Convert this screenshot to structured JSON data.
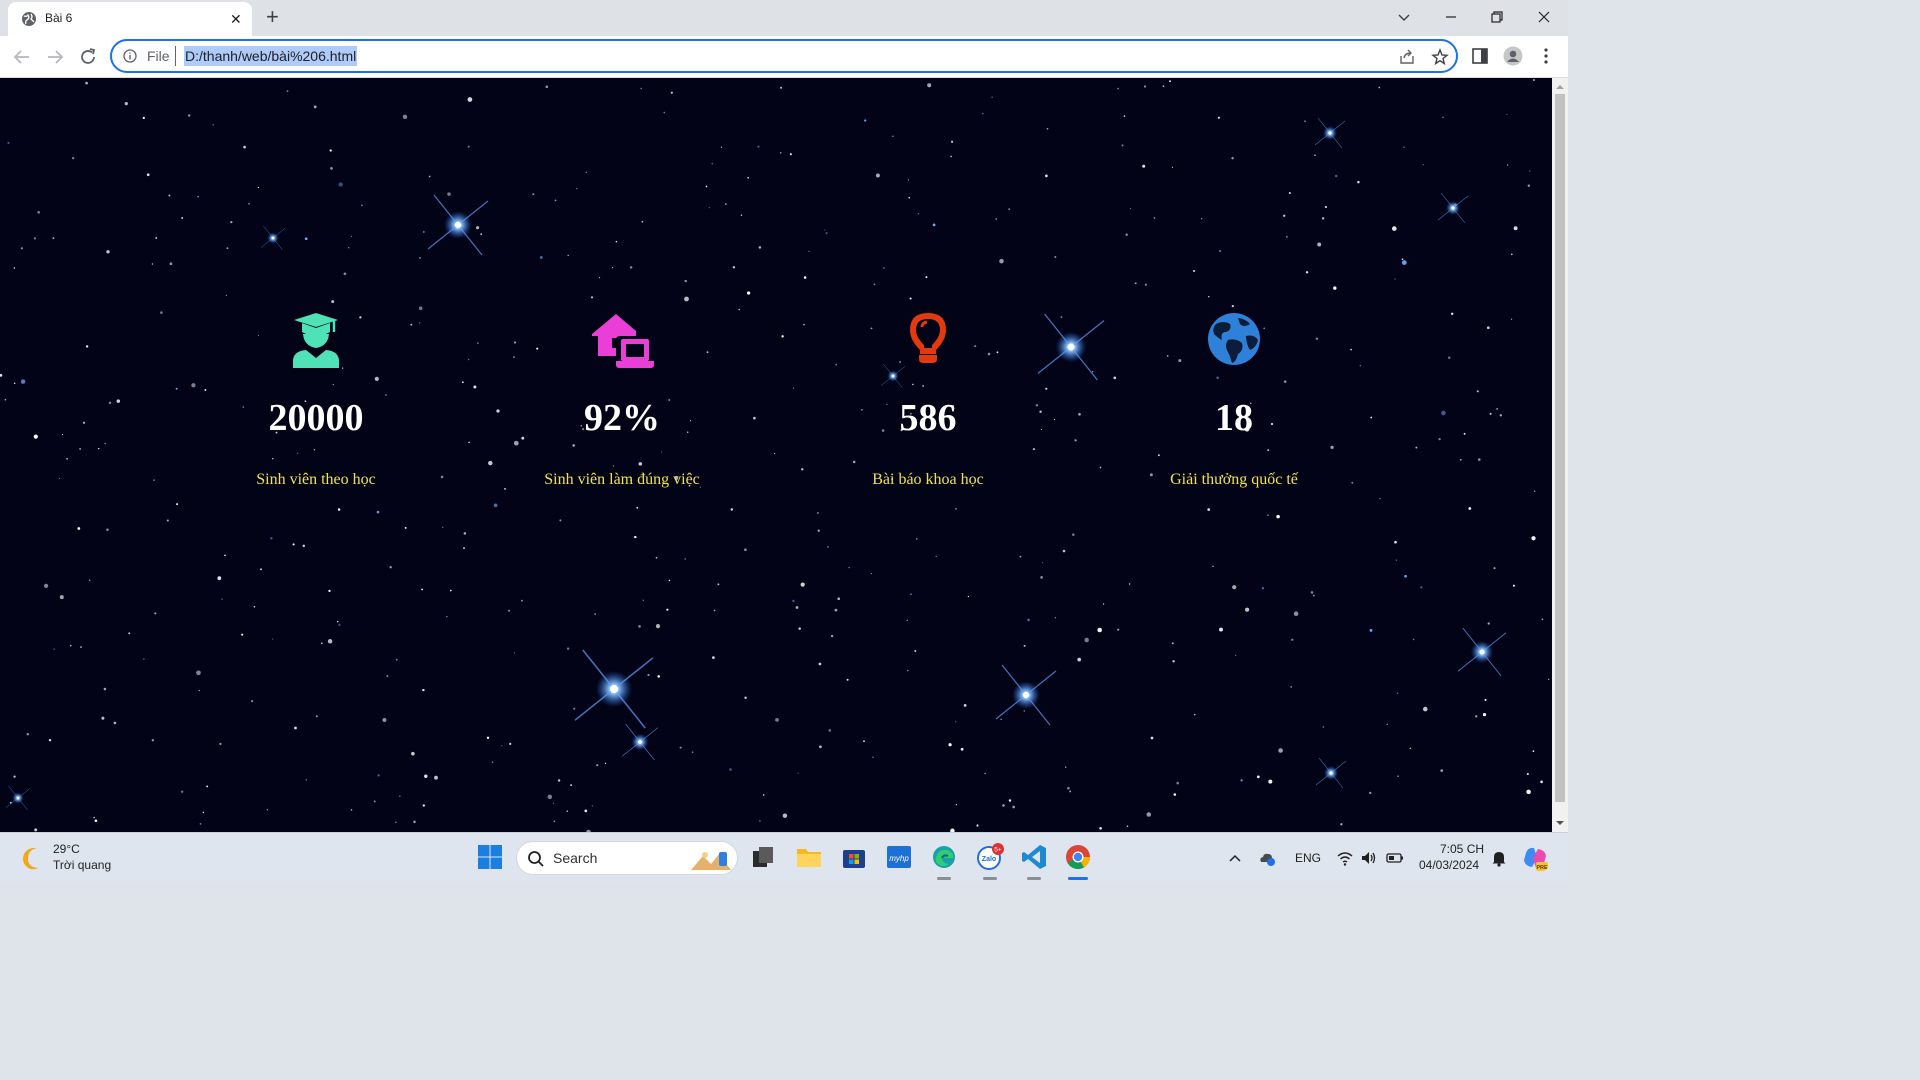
{
  "browser": {
    "tab_title": "Bài 6",
    "url_scheme": "File",
    "url": "D:/thanh/web/bài%206.html",
    "icons": [
      "globe-icon",
      "close-icon",
      "plus-icon",
      "chevron-down-icon",
      "minimize-icon",
      "restore-icon",
      "close-window-icon",
      "back-icon",
      "forward-icon",
      "reload-icon",
      "info-icon",
      "share-icon",
      "star-icon",
      "side-panel-icon",
      "profile-icon",
      "kebab-menu-icon"
    ]
  },
  "stats": [
    {
      "icon": "graduate-icon",
      "color": "#4ee2b6",
      "value": "20000",
      "label": "Sinh viên theo học"
    },
    {
      "icon": "house-laptop-icon",
      "color": "#ea3fd6",
      "value": "92%",
      "label": "Sinh viên làm đúng việc"
    },
    {
      "icon": "lightbulb-icon",
      "color": "#e2390f",
      "value": "586",
      "label": "Bài báo khoa học"
    },
    {
      "icon": "globe-earth-icon",
      "color": "#2f80d9",
      "value": "18",
      "label": "Giải thưởng quốc tế"
    }
  ],
  "page_colors": {
    "background": "#020316",
    "value_text": "#ffffff",
    "label_text": "#f1e34a"
  },
  "taskbar": {
    "weather_temp": "29°C",
    "weather_desc": "Trời quang",
    "search_placeholder": "Search",
    "language": "ENG",
    "time": "7:05 CH",
    "date": "04/03/2024",
    "zalo_badge": "5+",
    "apps": [
      "start-icon",
      "task-view-icon",
      "file-explorer-icon",
      "store-icon",
      "myhp-icon",
      "edge-icon",
      "zalo-icon",
      "vscode-icon",
      "chrome-icon"
    ]
  }
}
